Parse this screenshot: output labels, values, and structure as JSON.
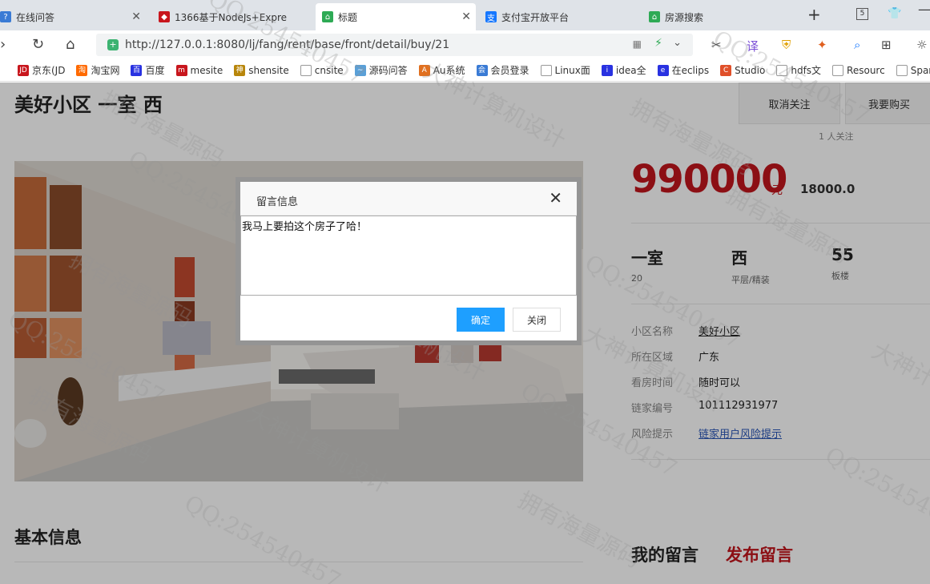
{
  "tabs": [
    {
      "label": "在线问答",
      "icon": "qa-icon",
      "color": "#3a7bd5"
    },
    {
      "label": "1366基于NodeJs+Expre",
      "icon": "project-icon",
      "color": "#c8161d"
    },
    {
      "label": "标题",
      "icon": "page-icon",
      "color": "#2eaa55"
    },
    {
      "label": "支付宝开放平台",
      "icon": "alipay-icon",
      "color": "#1677ff"
    },
    {
      "label": "房源搜索",
      "icon": "page-icon",
      "color": "#2eaa55"
    }
  ],
  "tab_count": "5",
  "url": {
    "host": "http://127.0.0.1",
    "path": ":8080/lj/fang/rent/base/front/detail/buy/21"
  },
  "bookmarks": [
    {
      "label": "京东(JD",
      "color": "#c8161d",
      "glyph": "JD"
    },
    {
      "label": "淘宝网",
      "color": "#ff6a00",
      "glyph": "淘"
    },
    {
      "label": "百度",
      "color": "#2932e1",
      "glyph": "百"
    },
    {
      "label": "mesite",
      "color": "#c8161d",
      "glyph": "m"
    },
    {
      "label": "shensite",
      "color": "#b8860b",
      "glyph": "神"
    },
    {
      "label": "cnsite",
      "color": "#999999",
      "glyph": ""
    },
    {
      "label": "源码问答",
      "color": "#5aa0d8",
      "glyph": "~"
    },
    {
      "label": "Au系统",
      "color": "#e07020",
      "glyph": "A"
    },
    {
      "label": "会员登录",
      "color": "#3a7bd5",
      "glyph": "会"
    },
    {
      "label": "Linux面",
      "color": "#999999",
      "glyph": ""
    },
    {
      "label": "idea全",
      "color": "#2932e1",
      "glyph": "i"
    },
    {
      "label": "在eclips",
      "color": "#2932e1",
      "glyph": "e"
    },
    {
      "label": "Studio",
      "color": "#e0502a",
      "glyph": "C"
    },
    {
      "label": "hdfs文",
      "color": "#999999",
      "glyph": ""
    },
    {
      "label": "Resourc",
      "color": "#999999",
      "glyph": ""
    },
    {
      "label": "Spar",
      "color": "#999999",
      "glyph": ""
    }
  ],
  "house": {
    "title": "美好小区 一室 西",
    "follow_button": "取消关注",
    "buy_button": "我要购买",
    "follow_count": "1 人关注",
    "price": "990000",
    "price_unit": "元",
    "unit_price": "18000.0",
    "attrs": [
      {
        "big": "一室",
        "small": "20"
      },
      {
        "big": "西",
        "small": "平层/精装"
      },
      {
        "big": "55",
        "small": "板楼"
      }
    ],
    "info": [
      {
        "label": "小区名称",
        "value": "美好小区"
      },
      {
        "label": "所在区域",
        "value": "广东"
      },
      {
        "label": "看房时间",
        "value": "随时可以"
      },
      {
        "label": "链家编号",
        "value": "101112931977"
      },
      {
        "label": "风险提示",
        "value": "链家用户风险提示"
      }
    ],
    "basic_info_heading": "基本信息",
    "my_messages_heading": "我的留言",
    "post_message_link": "发布留言"
  },
  "dialog": {
    "title": "留言信息",
    "message": "我马上要拍这个房子了哈！",
    "ok_label": "确定",
    "cancel_label": "关闭"
  },
  "watermark": {
    "lines": [
      "QQ:254540457",
      "拥有海量源码",
      "大神计算机设计"
    ]
  },
  "colors": {
    "price_red": "#c3151c",
    "accent_blue": "#1e9fff",
    "link_blue": "#2a56b8"
  }
}
